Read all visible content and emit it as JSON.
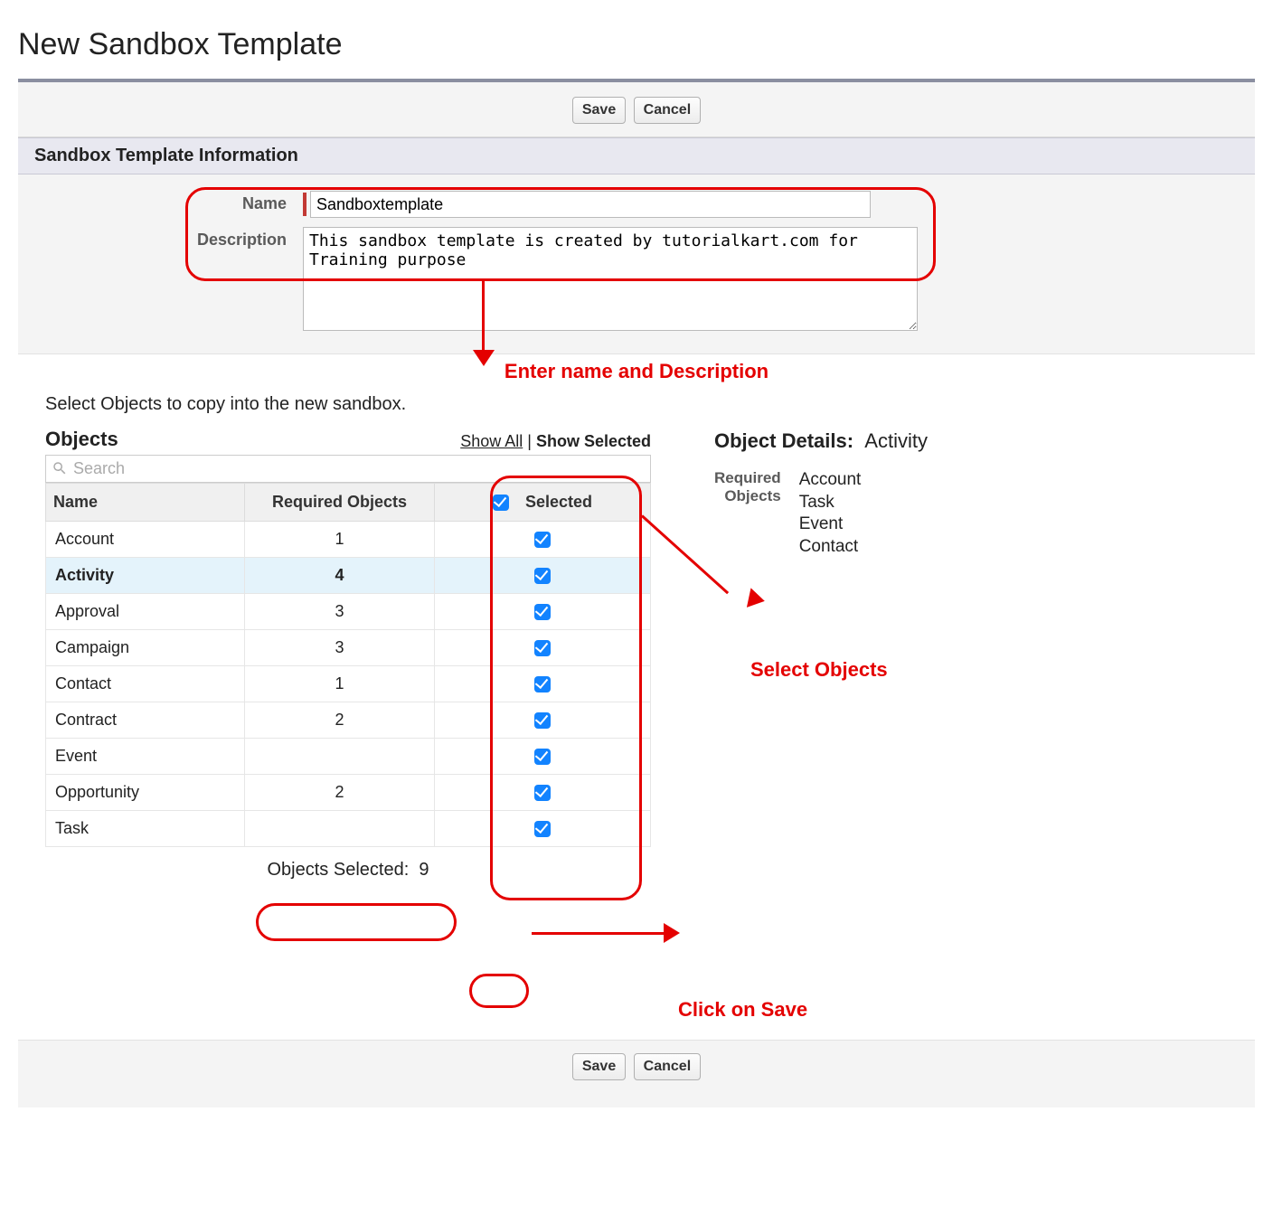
{
  "page_title": "New Sandbox Template",
  "buttons": {
    "save": "Save",
    "cancel": "Cancel"
  },
  "section_header": "Sandbox Template Information",
  "form": {
    "name_label": "Name",
    "name_value": "Sandboxtemplate",
    "description_label": "Description",
    "description_value": "This sandbox template is created by tutorialkart.com for Training purpose"
  },
  "annotations": {
    "enter_name": "Enter name and Description",
    "select_objects": "Select Objects",
    "click_save": "Click on Save"
  },
  "objects": {
    "intro": "Select Objects to copy into the new sandbox.",
    "title": "Objects",
    "show_all": "Show All",
    "show_selected": "Show Selected",
    "search_placeholder": "Search",
    "columns": {
      "name": "Name",
      "required": "Required Objects",
      "selected": "Selected"
    },
    "rows": [
      {
        "name": "Account",
        "required": "1",
        "selected": true,
        "highlight": false
      },
      {
        "name": "Activity",
        "required": "4",
        "selected": true,
        "highlight": true
      },
      {
        "name": "Approval",
        "required": "3",
        "selected": true,
        "highlight": false
      },
      {
        "name": "Campaign",
        "required": "3",
        "selected": true,
        "highlight": false
      },
      {
        "name": "Contact",
        "required": "1",
        "selected": true,
        "highlight": false
      },
      {
        "name": "Contract",
        "required": "2",
        "selected": true,
        "highlight": false
      },
      {
        "name": "Event",
        "required": "",
        "selected": true,
        "highlight": false
      },
      {
        "name": "Opportunity",
        "required": "2",
        "selected": true,
        "highlight": false
      },
      {
        "name": "Task",
        "required": "",
        "selected": true,
        "highlight": false
      }
    ],
    "selected_count_label": "Objects Selected:",
    "selected_count": "9"
  },
  "details": {
    "title_label": "Object Details:",
    "object_name": "Activity",
    "required_label_1": "Required",
    "required_label_2": "Objects",
    "required_list": [
      "Account",
      "Task",
      "Event",
      "Contact"
    ]
  }
}
